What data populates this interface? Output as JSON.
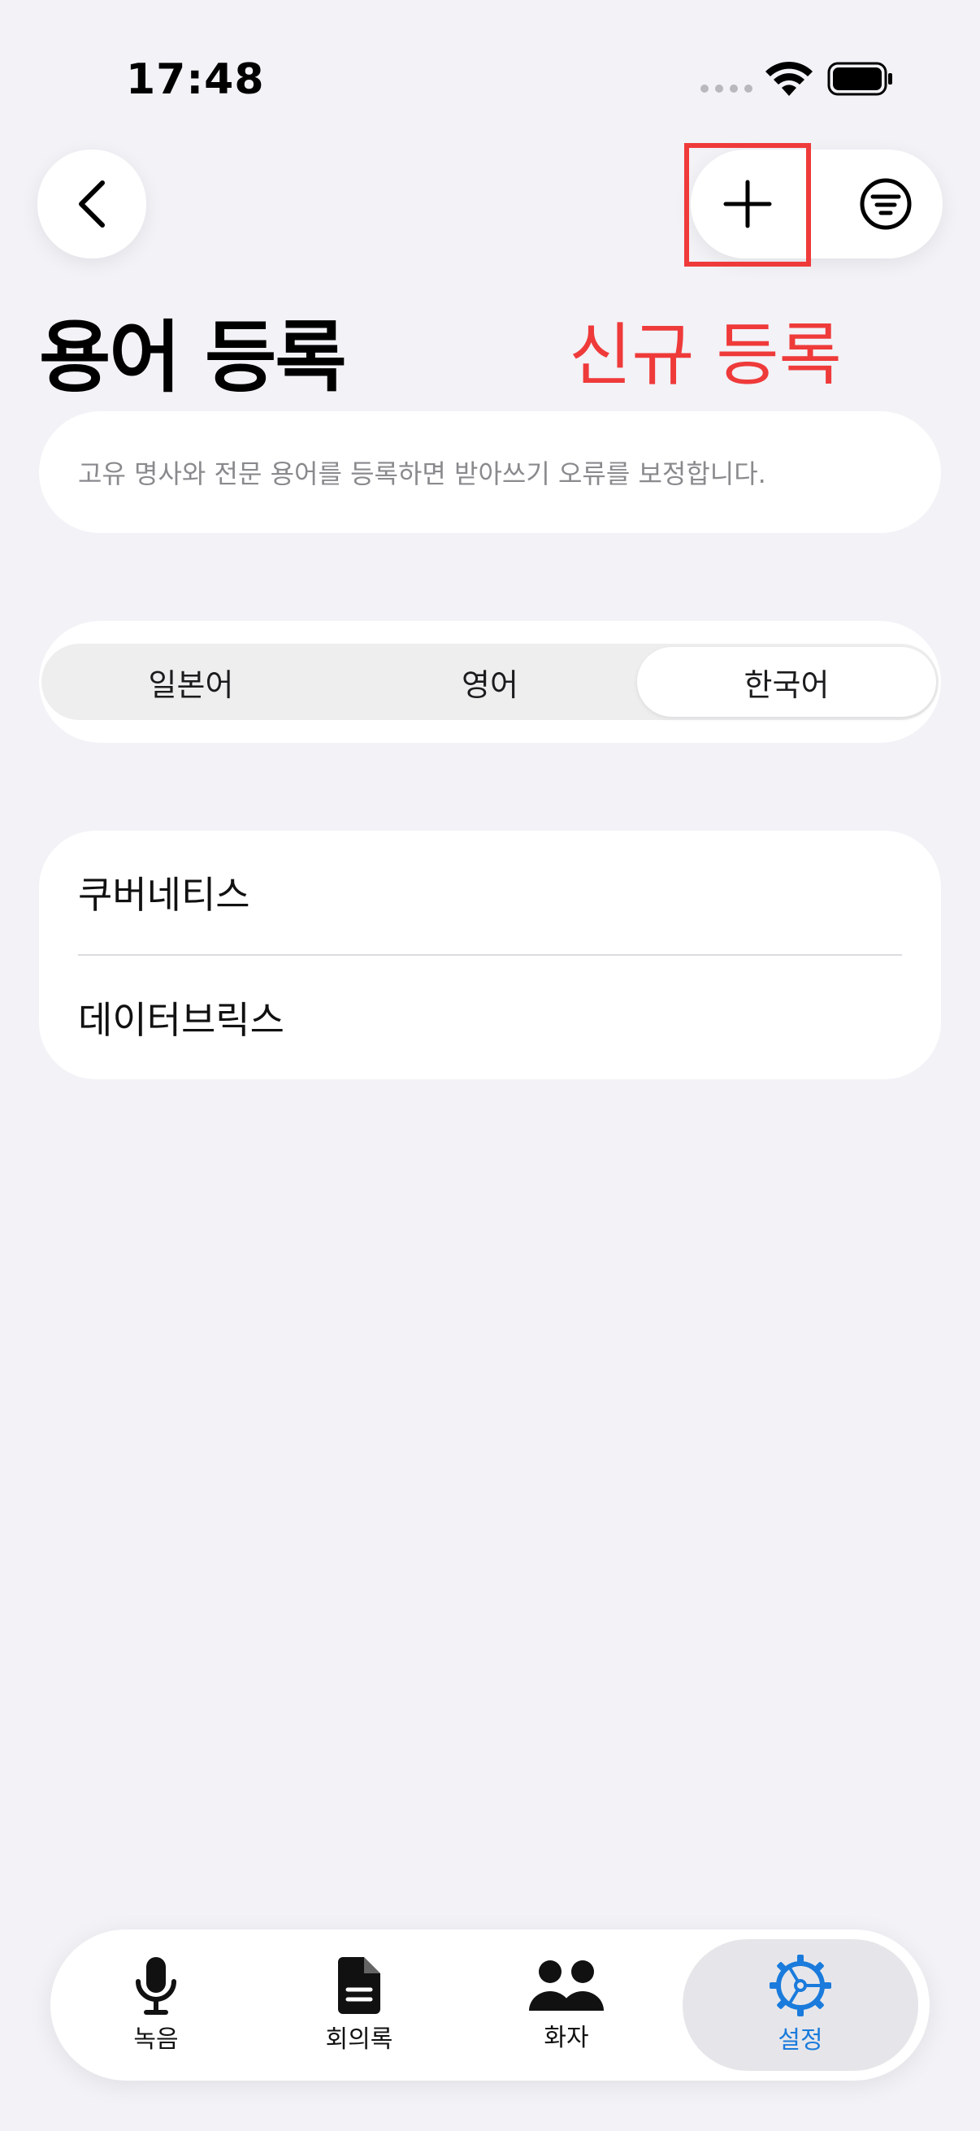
{
  "status_bar": {
    "time": "17:48"
  },
  "nav": {
    "back_icon": "chevron-left-icon",
    "add_icon": "plus-icon",
    "filter_icon": "filter-icon"
  },
  "header": {
    "title": "용어 등록",
    "annotation": "신규 등록",
    "annotation_color": "#ef3a3a"
  },
  "info": {
    "description": "고유 명사와 전문 용어를 등록하면 받아쓰기 오류를 보정합니다."
  },
  "segmented": {
    "options": [
      "일본어",
      "영어",
      "한국어"
    ],
    "selected": "한국어"
  },
  "terms": {
    "items": [
      "쿠버네티스",
      "데이터브릭스"
    ]
  },
  "tab_bar": {
    "items": [
      {
        "label": "녹음",
        "icon": "microphone-icon"
      },
      {
        "label": "회의록",
        "icon": "document-icon"
      },
      {
        "label": "화자",
        "icon": "people-icon"
      },
      {
        "label": "설정",
        "icon": "gear-icon"
      }
    ],
    "active": "설정",
    "active_color": "#1a7bdc"
  }
}
